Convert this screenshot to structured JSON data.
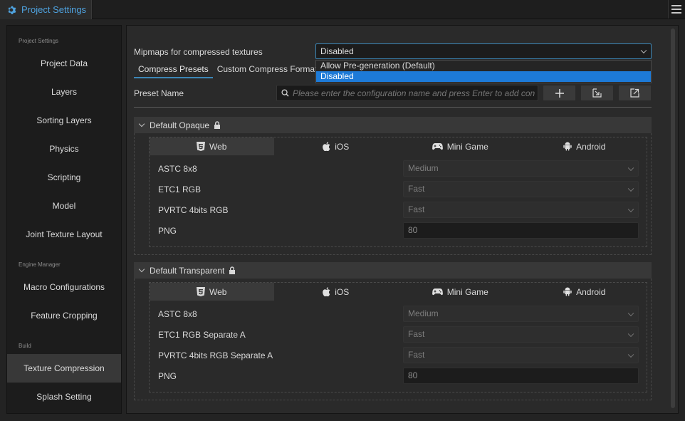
{
  "window": {
    "tab_title": "Project Settings"
  },
  "sidebar": {
    "groups": [
      {
        "title": "Project Settings"
      },
      {
        "title": "Engine Manager"
      },
      {
        "title": "Build"
      }
    ],
    "items": [
      {
        "label": "Project Data"
      },
      {
        "label": "Layers"
      },
      {
        "label": "Sorting Layers"
      },
      {
        "label": "Physics"
      },
      {
        "label": "Scripting"
      },
      {
        "label": "Model"
      },
      {
        "label": "Joint Texture Layout"
      },
      {
        "label": "Macro Configurations"
      },
      {
        "label": "Feature Cropping"
      },
      {
        "label": "Texture Compression",
        "active": true
      },
      {
        "label": "Splash Setting"
      }
    ]
  },
  "main": {
    "mipmaps_label": "Mipmaps for compressed textures",
    "mipmaps_value": "Disabled",
    "mipmaps_options": [
      "Allow Pre-generation (Default)",
      "Disabled"
    ],
    "tabs": [
      {
        "label": "Compress Presets",
        "active": true
      },
      {
        "label": "Custom Compress Format"
      }
    ],
    "preset_name_label": "Preset Name",
    "search_placeholder": "Please enter the configuration name and press Enter to add configuration",
    "action_icons": [
      "plus-icon",
      "import-icon",
      "export-icon"
    ],
    "platform_tabs": [
      {
        "label": "Web",
        "icon": "html5-icon"
      },
      {
        "label": "iOS",
        "icon": "apple-icon"
      },
      {
        "label": "Mini Game",
        "icon": "gamepad-icon"
      },
      {
        "label": "Android",
        "icon": "android-icon"
      }
    ],
    "sections": [
      {
        "title": "Default Opaque",
        "rows": [
          {
            "label": "ASTC 8x8",
            "value": "Medium",
            "kind": "select"
          },
          {
            "label": "ETC1 RGB",
            "value": "Fast",
            "kind": "select"
          },
          {
            "label": "PVRTC 4bits RGB",
            "value": "Fast",
            "kind": "select"
          },
          {
            "label": "PNG",
            "value": "80",
            "kind": "input"
          }
        ]
      },
      {
        "title": "Default Transparent",
        "rows": [
          {
            "label": "ASTC 8x8",
            "value": "Medium",
            "kind": "select"
          },
          {
            "label": "ETC1 RGB Separate A",
            "value": "Fast",
            "kind": "select"
          },
          {
            "label": "PVRTC 4bits RGB Separate A",
            "value": "Fast",
            "kind": "select"
          },
          {
            "label": "PNG",
            "value": "80",
            "kind": "input"
          }
        ]
      }
    ]
  },
  "colors": {
    "accent": "#4fa3e0",
    "selection": "#1d7ad7"
  }
}
